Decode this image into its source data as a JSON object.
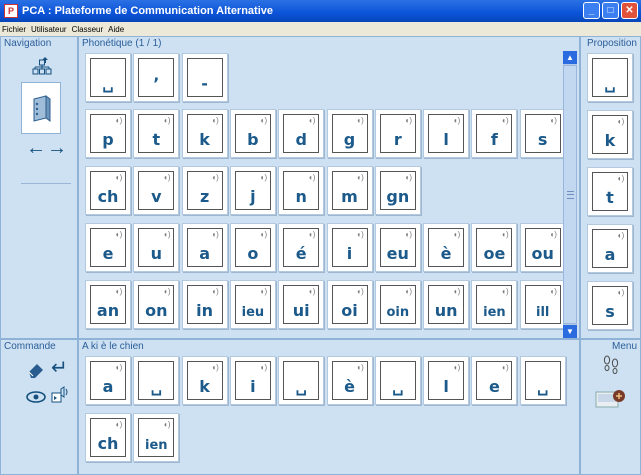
{
  "window": {
    "title": "PCA : Plateforme de Communication Alternative",
    "app_icon": "pca-logo-icon",
    "controls": [
      "minimize-icon",
      "maximize-icon",
      "close-icon"
    ]
  },
  "menubar": {
    "items": [
      "Fichier",
      "Utilisateur",
      "Classeur",
      "Aide"
    ]
  },
  "navigation": {
    "title": "Navigation",
    "icons": [
      "hierarchy-up-icon",
      "binder-icon",
      "arrow-left-icon",
      "arrow-right-icon"
    ]
  },
  "phonetique": {
    "title": "Phonétique (1 / 1)",
    "rows": [
      [
        "␣",
        "’",
        "-"
      ],
      [
        "p",
        "t",
        "k",
        "b",
        "d",
        "g",
        "r",
        "l",
        "f",
        "s"
      ],
      [
        "ch",
        "v",
        "z",
        "j",
        "n",
        "m",
        "gn"
      ],
      [
        "e",
        "u",
        "a",
        "o",
        "é",
        "i",
        "eu",
        "è",
        "oe",
        "ou"
      ],
      [
        "an",
        "on",
        "in",
        "ieu",
        "ui",
        "oi",
        "oin",
        "un",
        "ien",
        "ill"
      ]
    ],
    "speaker_icon": "speaker-icon"
  },
  "proposition": {
    "title": "Proposition",
    "cards": [
      "␣",
      "k",
      "t",
      "a",
      "s"
    ]
  },
  "commande": {
    "title": "Commande",
    "icons": [
      "eraser-icon",
      "return-icon",
      "eye-icon",
      "speak-icon"
    ]
  },
  "sentence": {
    "title": "A ki è le chien",
    "cards": [
      "a",
      "␣",
      "k",
      "i",
      "␣",
      "è",
      "␣",
      "l",
      "e",
      "␣",
      "ch",
      "ien"
    ]
  },
  "menu": {
    "title": "Menu",
    "icons": [
      "footprints-icon",
      "settings-icon"
    ]
  }
}
